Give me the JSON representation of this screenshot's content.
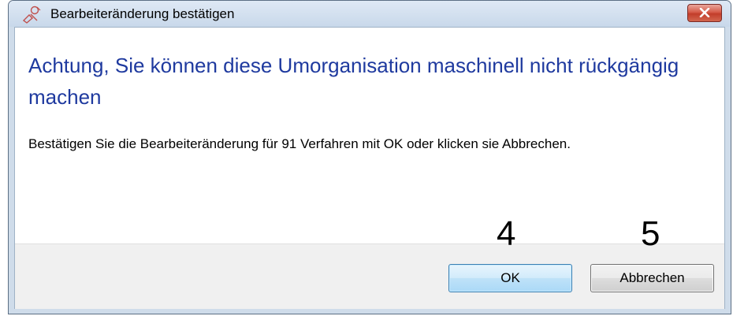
{
  "window": {
    "title": "Bearbeiteränderung bestätigen",
    "app_icon": "tools-icon",
    "close_icon": "close-icon"
  },
  "dialog": {
    "main_instruction": "Achtung, Sie können diese Umorganisation maschinell nicht rückgängig machen",
    "content": "Bestätigen Sie die Bearbeiteränderung für 91 Verfahren mit OK oder klicken sie Abbrechen."
  },
  "buttons": {
    "ok_label": "OK",
    "cancel_label": "Abbrechen"
  },
  "annotations": {
    "ok_marker": "4",
    "cancel_marker": "5"
  },
  "colors": {
    "instruction_text": "#1f3a9f",
    "close_button": "#c9432f",
    "ok_button_border": "#3c7fb1"
  }
}
